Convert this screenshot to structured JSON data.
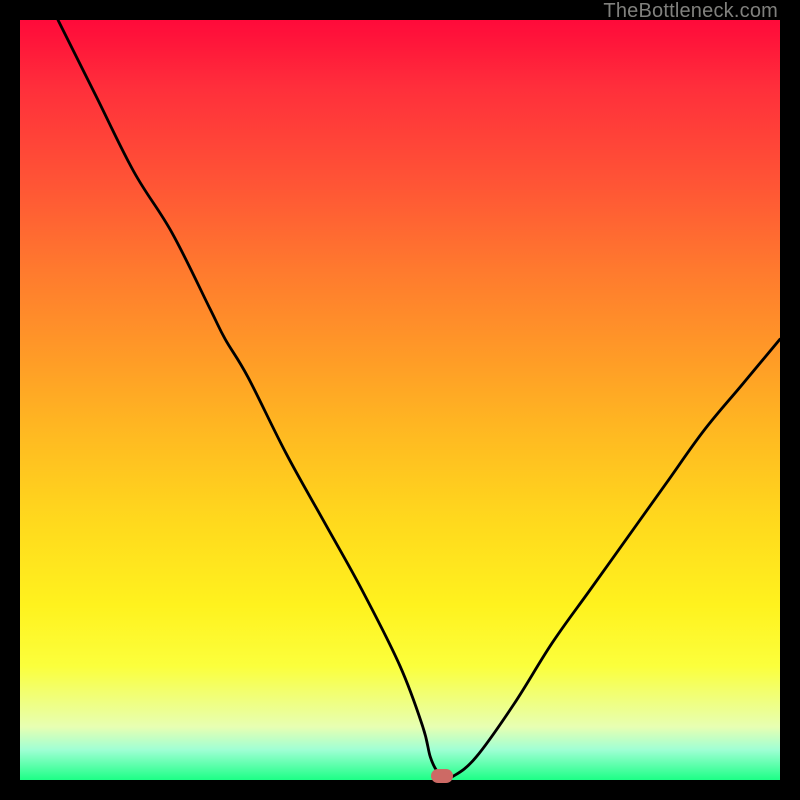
{
  "watermark": "TheBottleneck.com",
  "chart_data": {
    "type": "line",
    "title": "",
    "xlabel": "",
    "ylabel": "",
    "xlim": [
      0,
      100
    ],
    "ylim": [
      0,
      100
    ],
    "grid": false,
    "series": [
      {
        "name": "curve",
        "x": [
          5,
          10,
          15,
          20,
          25,
          27,
          30,
          35,
          40,
          45,
          50,
          53,
          54,
          55,
          56,
          57,
          60,
          65,
          70,
          75,
          80,
          85,
          90,
          95,
          100
        ],
        "values": [
          100,
          90,
          80,
          72,
          62,
          58,
          53,
          43,
          34,
          25,
          15,
          7,
          3,
          1,
          0.5,
          0.5,
          3,
          10,
          18,
          25,
          32,
          39,
          46,
          52,
          58
        ]
      }
    ],
    "marker": {
      "x": 55.5,
      "y": 0.5,
      "color": "#cd6a65"
    },
    "background_gradient": {
      "top": "#ff0a3a",
      "bottom": "#1dff86"
    }
  }
}
